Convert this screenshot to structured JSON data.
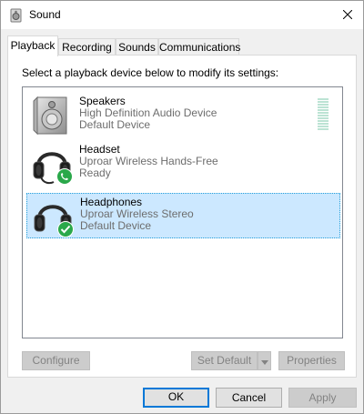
{
  "window": {
    "title": "Sound",
    "close_glyph": "✕"
  },
  "tabs": [
    {
      "label": "Playback",
      "active": true
    },
    {
      "label": "Recording",
      "active": false
    },
    {
      "label": "Sounds",
      "active": false
    },
    {
      "label": "Communications",
      "active": false
    }
  ],
  "playback": {
    "instructions": "Select a playback device below to modify its settings:",
    "devices": [
      {
        "name": "Speakers",
        "line1": "High Definition Audio Device",
        "line2": "Default Device",
        "icon": "speaker-icon",
        "selected": false
      },
      {
        "name": "Headset",
        "line1": "Uproar Wireless Hands-Free",
        "line2": "Ready",
        "icon": "headset-icon",
        "status_badge": "phone-badge",
        "selected": false
      },
      {
        "name": "Headphones",
        "line1": "Uproar Wireless Stereo",
        "line2": "Default Device",
        "icon": "headphones-icon",
        "status_badge": "checkmark-badge",
        "selected": true
      }
    ],
    "level_meter_segments": 12
  },
  "panel_buttons": {
    "configure": "Configure",
    "set_default": "Set Default",
    "properties": "Properties"
  },
  "dialog_buttons": {
    "ok": "OK",
    "cancel": "Cancel",
    "apply": "Apply"
  },
  "colors": {
    "selection_bg": "#cce8ff",
    "selection_border": "#26a0da",
    "accent": "#0078d7",
    "status_green": "#2aa84a"
  }
}
